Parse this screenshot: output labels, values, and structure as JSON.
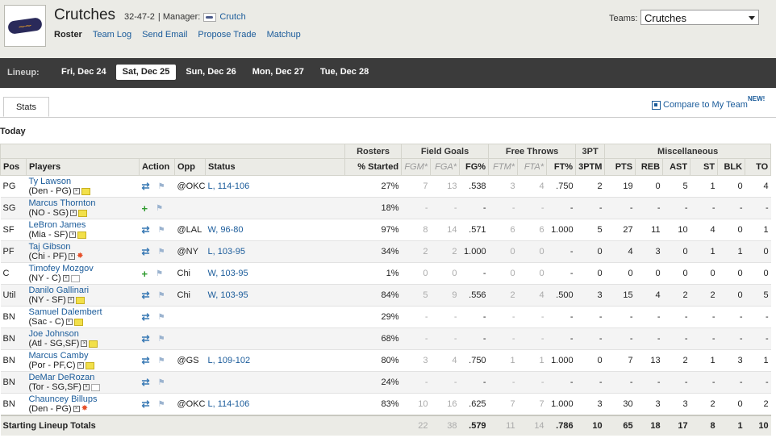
{
  "header": {
    "team_name": "Crutches",
    "record": "32-47-2",
    "manager_label": "| Manager:",
    "manager_name": "Crutch",
    "nav": [
      "Roster",
      "Team Log",
      "Send Email",
      "Propose Trade",
      "Matchup"
    ],
    "teams_label": "Teams:",
    "teams_selected": "Crutches"
  },
  "lineup": {
    "label": "Lineup:",
    "dates": [
      "Fri, Dec 24",
      "Sat, Dec 25",
      "Sun, Dec 26",
      "Mon, Dec 27",
      "Tue, Dec 28"
    ],
    "active_index": 1
  },
  "tabs": {
    "stats": "Stats",
    "compare": "Compare to My Team",
    "new_badge": "NEW!"
  },
  "section_title": "Today",
  "table": {
    "group_headers": {
      "rosters": "Rosters",
      "field_goals": "Field Goals",
      "free_throws": "Free Throws",
      "three_pt": "3PT",
      "misc": "Miscellaneous"
    },
    "columns": [
      "Pos",
      "Players",
      "Action",
      "Opp",
      "Status",
      "% Started",
      "FGM*",
      "FGA*",
      "FG%",
      "FTM*",
      "FTA*",
      "FT%",
      "3PTM",
      "PTS",
      "REB",
      "AST",
      "ST",
      "BLK",
      "TO"
    ],
    "rows": [
      {
        "pos": "PG",
        "name": "Ty Lawson",
        "info": "(Den - PG)",
        "note": "note",
        "action": "swap",
        "opp": "@OKC",
        "status": "L, 114-106",
        "started": "27%",
        "fgm": "7",
        "fga": "13",
        "fgp": ".538",
        "ftm": "3",
        "fta": "4",
        "ftp": ".750",
        "tpm": "2",
        "pts": "19",
        "reb": "0",
        "ast": "5",
        "st": "1",
        "blk": "0",
        "to": "4"
      },
      {
        "pos": "SG",
        "name": "Marcus Thornton",
        "info": "(NO - SG)",
        "note": "note",
        "action": "add",
        "opp": "",
        "status": "",
        "started": "18%",
        "fgm": "-",
        "fga": "-",
        "fgp": "-",
        "ftm": "-",
        "fta": "-",
        "ftp": "-",
        "tpm": "-",
        "pts": "-",
        "reb": "-",
        "ast": "-",
        "st": "-",
        "blk": "-",
        "to": "-"
      },
      {
        "pos": "SF",
        "name": "LeBron James",
        "info": "(Mia - SF)",
        "note": "note",
        "action": "swap",
        "opp": "@LAL",
        "status": "W, 96-80",
        "started": "97%",
        "fgm": "8",
        "fga": "14",
        "fgp": ".571",
        "ftm": "6",
        "fta": "6",
        "ftp": "1.000",
        "tpm": "5",
        "pts": "27",
        "reb": "11",
        "ast": "10",
        "st": "4",
        "blk": "0",
        "to": "1"
      },
      {
        "pos": "PF",
        "name": "Taj Gibson",
        "info": "(Chi - PF)",
        "note": "star",
        "action": "swap",
        "opp": "@NY",
        "status": "L, 103-95",
        "started": "34%",
        "fgm": "2",
        "fga": "2",
        "fgp": "1.000",
        "ftm": "0",
        "fta": "0",
        "ftp": "-",
        "tpm": "0",
        "pts": "4",
        "reb": "3",
        "ast": "0",
        "st": "1",
        "blk": "1",
        "to": "0"
      },
      {
        "pos": "C",
        "name": "Timofey Mozgov",
        "info": "(NY - C)",
        "note": "empty",
        "action": "add",
        "opp": "Chi",
        "status": "W, 103-95",
        "started": "1%",
        "fgm": "0",
        "fga": "0",
        "fgp": "-",
        "ftm": "0",
        "fta": "0",
        "ftp": "-",
        "tpm": "0",
        "pts": "0",
        "reb": "0",
        "ast": "0",
        "st": "0",
        "blk": "0",
        "to": "0"
      },
      {
        "pos": "Util",
        "name": "Danilo Gallinari",
        "info": "(NY - SF)",
        "note": "note",
        "action": "swap",
        "opp": "Chi",
        "status": "W, 103-95",
        "started": "84%",
        "fgm": "5",
        "fga": "9",
        "fgp": ".556",
        "ftm": "2",
        "fta": "4",
        "ftp": ".500",
        "tpm": "3",
        "pts": "15",
        "reb": "4",
        "ast": "2",
        "st": "2",
        "blk": "0",
        "to": "5"
      },
      {
        "pos": "BN",
        "name": "Samuel Dalembert",
        "info": "(Sac - C)",
        "note": "note",
        "action": "swap",
        "opp": "",
        "status": "",
        "started": "29%",
        "fgm": "-",
        "fga": "-",
        "fgp": "-",
        "ftm": "-",
        "fta": "-",
        "ftp": "-",
        "tpm": "-",
        "pts": "-",
        "reb": "-",
        "ast": "-",
        "st": "-",
        "blk": "-",
        "to": "-"
      },
      {
        "pos": "BN",
        "name": "Joe Johnson",
        "info": "(Atl - SG,SF)",
        "note": "note",
        "action": "swap",
        "opp": "",
        "status": "",
        "started": "68%",
        "fgm": "-",
        "fga": "-",
        "fgp": "-",
        "ftm": "-",
        "fta": "-",
        "ftp": "-",
        "tpm": "-",
        "pts": "-",
        "reb": "-",
        "ast": "-",
        "st": "-",
        "blk": "-",
        "to": "-"
      },
      {
        "pos": "BN",
        "name": "Marcus Camby",
        "info": "(Por - PF,C)",
        "note": "note",
        "action": "swap",
        "opp": "@GS",
        "status": "L, 109-102",
        "started": "80%",
        "fgm": "3",
        "fga": "4",
        "fgp": ".750",
        "ftm": "1",
        "fta": "1",
        "ftp": "1.000",
        "tpm": "0",
        "pts": "7",
        "reb": "13",
        "ast": "2",
        "st": "1",
        "blk": "3",
        "to": "1"
      },
      {
        "pos": "BN",
        "name": "DeMar DeRozan",
        "info": "(Tor - SG,SF)",
        "note": "empty",
        "action": "swap",
        "opp": "",
        "status": "",
        "started": "24%",
        "fgm": "-",
        "fga": "-",
        "fgp": "-",
        "ftm": "-",
        "fta": "-",
        "ftp": "-",
        "tpm": "-",
        "pts": "-",
        "reb": "-",
        "ast": "-",
        "st": "-",
        "blk": "-",
        "to": "-"
      },
      {
        "pos": "BN",
        "name": "Chauncey Billups",
        "info": "(Den - PG)",
        "note": "star",
        "action": "swap",
        "opp": "@OKC",
        "status": "L, 114-106",
        "started": "83%",
        "fgm": "10",
        "fga": "16",
        "fgp": ".625",
        "ftm": "7",
        "fta": "7",
        "ftp": "1.000",
        "tpm": "3",
        "pts": "30",
        "reb": "3",
        "ast": "3",
        "st": "2",
        "blk": "0",
        "to": "2"
      }
    ],
    "totals": {
      "label": "Starting Lineup Totals",
      "fgm": "22",
      "fga": "38",
      "fgp": ".579",
      "ftm": "11",
      "fta": "14",
      "ftp": ".786",
      "tpm": "10",
      "pts": "65",
      "reb": "18",
      "ast": "17",
      "st": "8",
      "blk": "1",
      "to": "10"
    }
  }
}
